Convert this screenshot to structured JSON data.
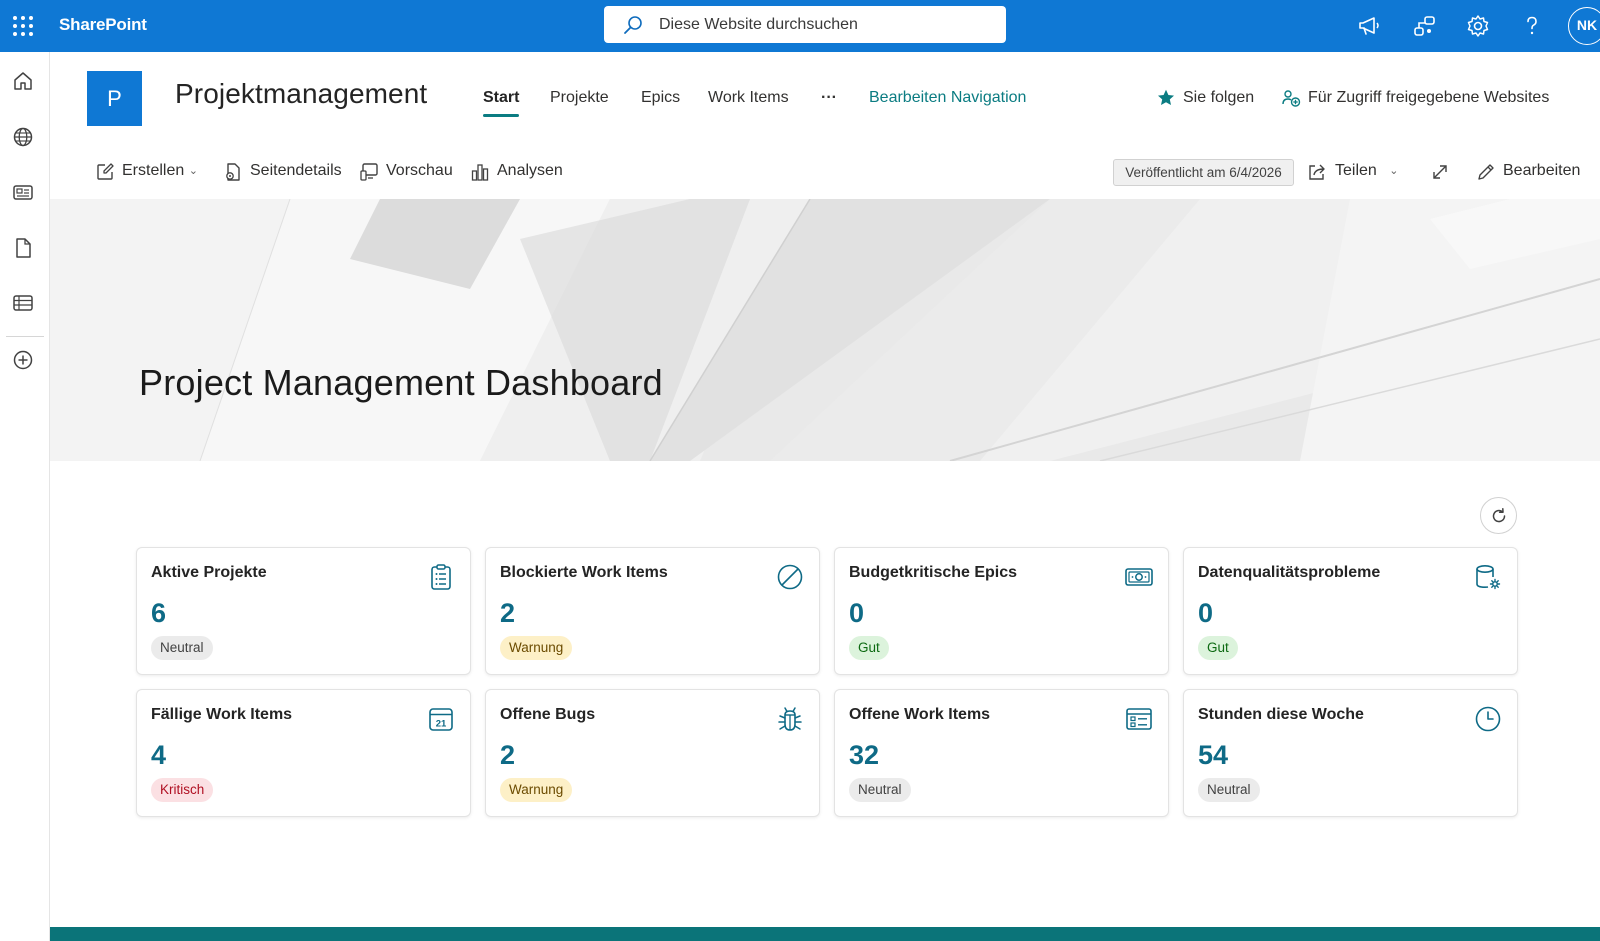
{
  "suite": {
    "app_name": "SharePoint",
    "search_placeholder": "Diese Website durchsuchen",
    "avatar_initials": "NK",
    "accent_color": "#0f78d4"
  },
  "site": {
    "logo_letter": "P",
    "title": "Projektmanagement",
    "nav": [
      "Start",
      "Projekte",
      "Epics",
      "Work Items",
      "···",
      "Bearbeiten Navigation"
    ],
    "follow_label": "Sie folgen",
    "shared_sites_label": "Für Zugriff freigegebene Websites"
  },
  "commands": {
    "create": "Erstellen",
    "page_details": "Seitendetails",
    "preview": "Vorschau",
    "analytics": "Analysen",
    "published": "Veröffentlicht am 6/4/2026",
    "share": "Teilen",
    "edit": "Bearbeiten"
  },
  "hero": {
    "title": "Project Management Dashboard"
  },
  "cards": [
    {
      "title": "Aktive Projekte",
      "value": "6",
      "badge": "Neutral",
      "status": "neutral",
      "icon": "clipboard-list-icon"
    },
    {
      "title": "Blockierte Work Items",
      "value": "2",
      "badge": "Warnung",
      "status": "warning",
      "icon": "blocked-icon"
    },
    {
      "title": "Budgetkritische Epics",
      "value": "0",
      "badge": "Gut",
      "status": "good",
      "icon": "money-icon"
    },
    {
      "title": "Datenqualitätsprobleme",
      "value": "0",
      "badge": "Gut",
      "status": "good",
      "icon": "database-settings-icon"
    },
    {
      "title": "Fällige Work Items",
      "value": "4",
      "badge": "Kritisch",
      "status": "critical",
      "icon": "calendar-icon"
    },
    {
      "title": "Offene Bugs",
      "value": "2",
      "badge": "Warnung",
      "status": "warning",
      "icon": "bug-icon"
    },
    {
      "title": "Offene Work Items",
      "value": "32",
      "badge": "Neutral",
      "status": "neutral",
      "icon": "list-form-icon"
    },
    {
      "title": "Stunden diese Woche",
      "value": "54",
      "badge": "Neutral",
      "status": "neutral",
      "icon": "clock-icon"
    }
  ],
  "calendar_icon_day": "21"
}
